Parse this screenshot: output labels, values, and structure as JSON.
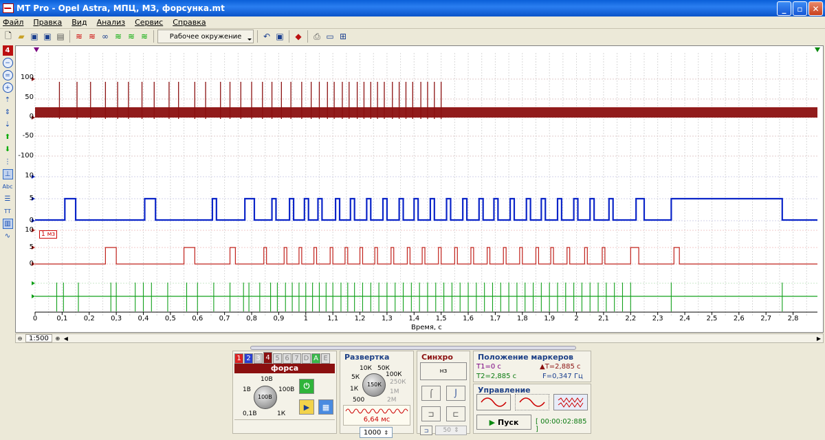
{
  "window": {
    "title": "MT Pro - Opel Astra, МПЦ, МЗ, форсунка.mt",
    "min": "_",
    "max": "▫",
    "close": "✕"
  },
  "menu": [
    "Файл",
    "Правка",
    "Вид",
    "Анализ",
    "Сервис",
    "Справка"
  ],
  "toolbar": {
    "environment_label": "Рабочее окружение"
  },
  "plot": {
    "y_labels_ch1": [
      "100",
      "50",
      "0",
      "-50",
      "-100"
    ],
    "y_labels_ch2": [
      "10",
      "5",
      "0"
    ],
    "y_labels_ch3": [
      "10",
      "5",
      "0"
    ],
    "badge": "1 мз",
    "x_ticks": [
      "0",
      "0,1",
      "0,2",
      "0,3",
      "0,4",
      "0,5",
      "0,6",
      "0,7",
      "0,8",
      "0,9",
      "1",
      "1,1",
      "1,2",
      "1,3",
      "1,4",
      "1,5",
      "1,6",
      "1,7",
      "1,8",
      "1,9",
      "2",
      "2,1",
      "2,2",
      "2,3",
      "2,4",
      "2,5",
      "2,6",
      "2,7",
      "2,8"
    ],
    "x_label": "Время, с",
    "colors": {
      "ch1": "#8b1010",
      "ch2": "#0a24c8",
      "ch3": "#c0201a",
      "ch4": "#11a01a"
    }
  },
  "chart_data": {
    "type": "line",
    "x_range": [
      0,
      2.89
    ],
    "xlabel": "Время, с",
    "series": [
      {
        "pulses": [
          0.09,
          0.155,
          0.205,
          0.26,
          0.305,
          0.345,
          0.395,
          0.44,
          0.495,
          0.53,
          0.59,
          0.63,
          0.685,
          0.72,
          0.76,
          0.8,
          0.84,
          0.875,
          0.91,
          0.945,
          0.985,
          1.02,
          1.05,
          1.08,
          1.105,
          1.135,
          1.16,
          1.19,
          1.215,
          1.24,
          1.265,
          1.29,
          1.32,
          1.345,
          1.37,
          1.395,
          1.425,
          1.45,
          1.475,
          1.5
        ]
      },
      {
        "high": [
          [
            0.11,
            0.15
          ],
          [
            0.405,
            0.445
          ],
          [
            0.655,
            0.67
          ],
          [
            0.775,
            0.81
          ],
          [
            0.875,
            0.89
          ],
          [
            0.94,
            0.955
          ],
          [
            0.995,
            1.01
          ],
          [
            1.045,
            1.06
          ],
          [
            1.11,
            1.125
          ],
          [
            1.165,
            1.18
          ],
          [
            1.225,
            1.24
          ],
          [
            1.285,
            1.3
          ],
          [
            1.345,
            1.36
          ],
          [
            1.4,
            1.415
          ],
          [
            1.46,
            1.475
          ],
          [
            1.52,
            1.535
          ],
          [
            1.58,
            1.595
          ],
          [
            1.64,
            1.655
          ],
          [
            1.695,
            1.71
          ],
          [
            1.755,
            1.77
          ],
          [
            1.815,
            1.83
          ],
          [
            1.87,
            1.885
          ],
          [
            1.93,
            1.945
          ],
          [
            1.99,
            2.005
          ],
          [
            2.05,
            2.065
          ],
          [
            2.12,
            2.135
          ],
          [
            2.22,
            2.25
          ],
          [
            2.35,
            2.76
          ]
        ]
      },
      {
        "high": [
          [
            0.26,
            0.3
          ],
          [
            0.55,
            0.59
          ],
          [
            0.72,
            0.74
          ],
          [
            0.845,
            0.855
          ],
          [
            0.92,
            0.93
          ],
          [
            0.975,
            0.985
          ],
          [
            1.03,
            1.04
          ],
          [
            1.09,
            1.1
          ],
          [
            1.145,
            1.155
          ],
          [
            1.2,
            1.21
          ],
          [
            1.255,
            1.265
          ],
          [
            1.315,
            1.325
          ],
          [
            1.375,
            1.385
          ],
          [
            1.43,
            1.44
          ],
          [
            1.49,
            1.5
          ],
          [
            1.55,
            1.56
          ],
          [
            1.61,
            1.62
          ],
          [
            1.67,
            1.68
          ],
          [
            1.73,
            1.74
          ],
          [
            1.79,
            1.8
          ],
          [
            1.85,
            1.86
          ],
          [
            1.905,
            1.915
          ],
          [
            1.965,
            1.975
          ],
          [
            2.03,
            2.04
          ],
          [
            2.095,
            2.105
          ],
          [
            2.2,
            2.23
          ],
          [
            2.36,
            2.38
          ]
        ]
      },
      {
        "spikes": [
          0.08,
          0.105,
          0.16,
          0.28,
          0.3,
          0.37,
          0.4,
          0.43,
          0.49,
          0.56,
          0.6,
          0.66,
          0.72,
          0.77,
          0.79,
          0.83,
          0.87,
          0.895,
          0.925,
          0.95,
          0.975,
          1.0,
          1.025,
          1.05,
          1.075,
          1.1,
          1.13,
          1.155,
          1.18,
          1.21,
          1.24,
          1.27,
          1.3,
          1.33,
          1.36,
          1.39,
          1.42,
          1.45,
          1.48,
          1.51,
          1.54,
          1.57,
          1.6,
          1.63,
          1.66,
          1.69,
          1.72,
          1.75,
          1.78,
          1.81,
          1.84,
          1.87,
          1.9,
          1.93,
          1.96,
          1.99,
          2.02,
          2.05,
          2.08,
          2.11,
          2.14,
          2.17,
          2.2,
          2.35,
          2.76
        ]
      }
    ]
  },
  "scroll": {
    "zoom": "1:500"
  },
  "channel_panel": {
    "tabs": [
      "1",
      "2",
      "3",
      "4",
      "5",
      "6",
      "7",
      "D",
      "A",
      "E"
    ],
    "active_name": "форса",
    "knob_labels": [
      "10В",
      "1В",
      "100В",
      "0,1В",
      "1К",
      "100В"
    ]
  },
  "sweep": {
    "title": "Развертка",
    "knob_labels": [
      "10К",
      "50К",
      "5К",
      "100К",
      "250К",
      "1К",
      "1М",
      "500",
      "2М"
    ],
    "knob_value": "150К",
    "time_label": "6,64 мс",
    "points_value": "1000"
  },
  "sync": {
    "title": "Синхро",
    "source": "нз",
    "level": "50"
  },
  "markers": {
    "title": "Положение маркеров",
    "t1": "T1=0 с",
    "dt": "▲T=2,885 с",
    "t2": "T2=2,885 с",
    "f": "F=0,347 Гц"
  },
  "control": {
    "title": "Управление",
    "start_label": "Пуск",
    "timer": "[ 00:00:02:885 ]"
  }
}
